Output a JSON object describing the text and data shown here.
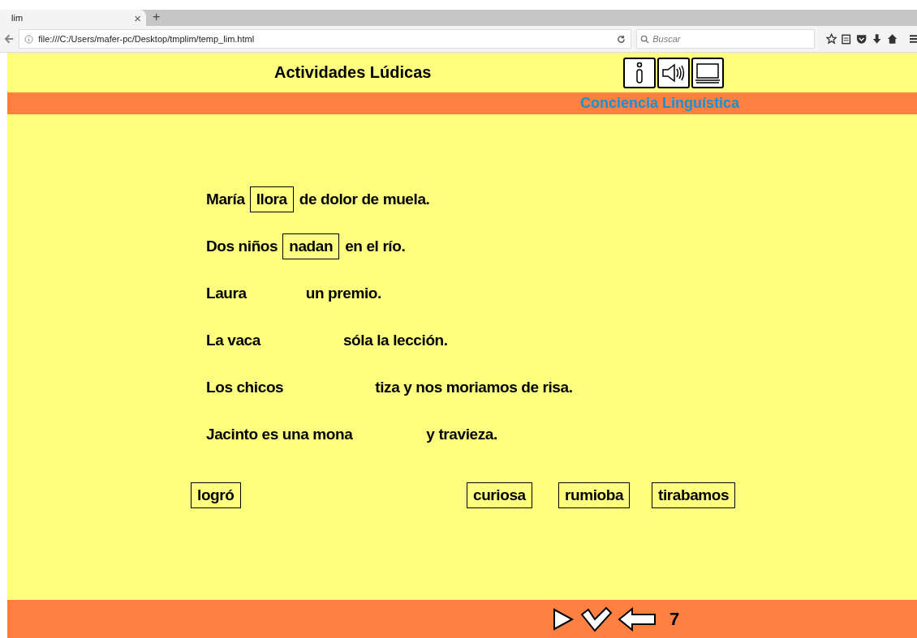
{
  "browser": {
    "tab_title": "lim",
    "tab_close": "×",
    "new_tab": "+",
    "url": "file:///C:/Users/mafer-pc/Desktop/tmplim/temp_lim.html",
    "search_placeholder": "Buscar"
  },
  "header": {
    "title": "Actividades Lúdicas",
    "subtitle": "Conciencia Linguística"
  },
  "sentences": [
    {
      "before": "María",
      "answer": "llora",
      "after": "de dolor de muela."
    },
    {
      "before": "Dos niños",
      "answer": "nadan",
      "after": "en el río."
    },
    {
      "before": "Laura",
      "after": "un premio."
    },
    {
      "before": "La vaca",
      "after": "sóla la lección."
    },
    {
      "before": "Los chicos",
      "after": "tiza y nos moriamos de risa."
    },
    {
      "before": "Jacinto es una mona",
      "after": "y travieza."
    }
  ],
  "word_bank": [
    "logró",
    "curiosa",
    "rumioba",
    "tirabamos"
  ],
  "footer": {
    "page": "7"
  }
}
